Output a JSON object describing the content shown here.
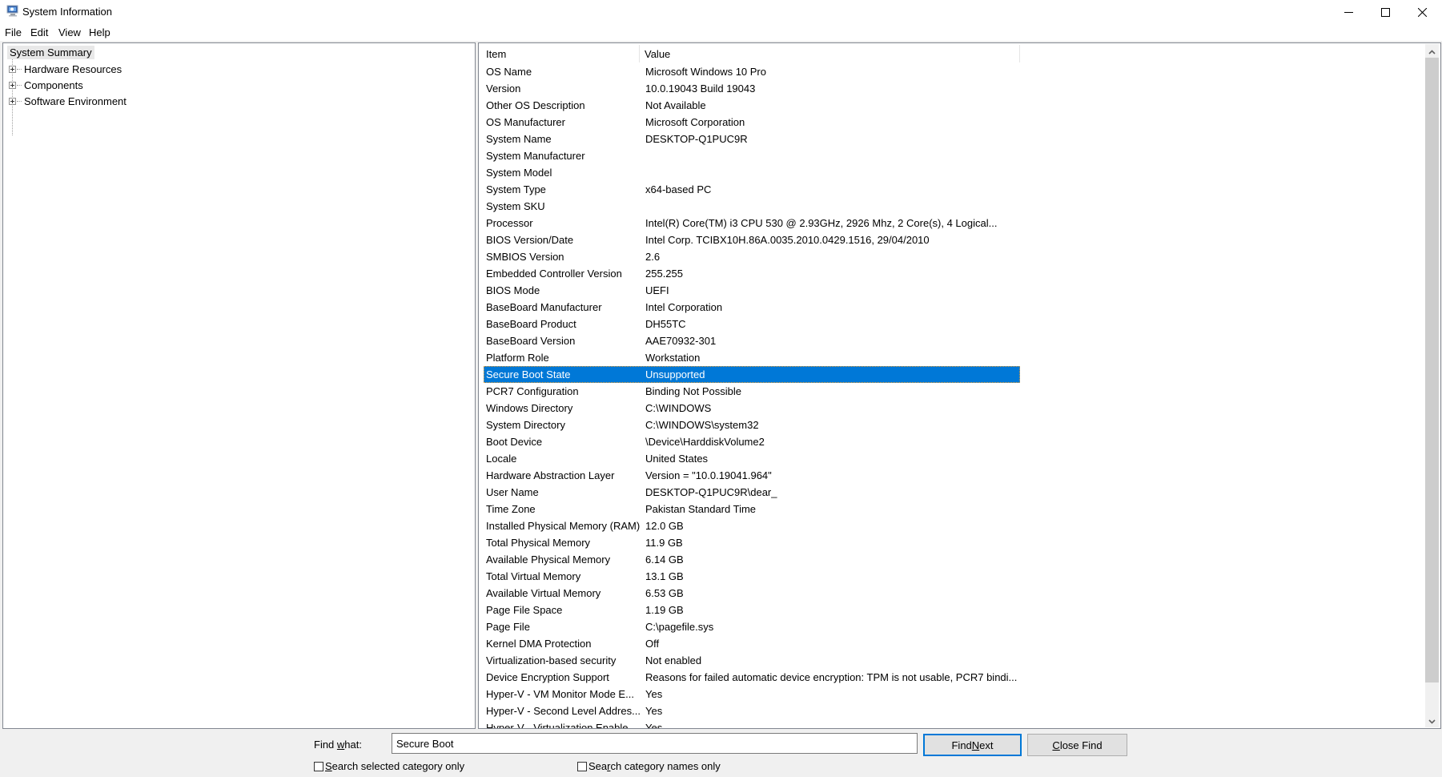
{
  "window": {
    "title": "System Information",
    "controls": {
      "minimize": "minimize",
      "maximize": "maximize",
      "close": "close"
    }
  },
  "menu": {
    "items": [
      "File",
      "Edit",
      "View",
      "Help"
    ]
  },
  "tree": {
    "root": "System Summary",
    "children": [
      "Hardware Resources",
      "Components",
      "Software Environment"
    ]
  },
  "list": {
    "headers": {
      "item": "Item",
      "value": "Value"
    },
    "selected_index": 18,
    "rows": [
      {
        "item": "OS Name",
        "value": "Microsoft Windows 10 Pro"
      },
      {
        "item": "Version",
        "value": "10.0.19043 Build 19043"
      },
      {
        "item": "Other OS Description",
        "value": "Not Available"
      },
      {
        "item": "OS Manufacturer",
        "value": "Microsoft Corporation"
      },
      {
        "item": "System Name",
        "value": "DESKTOP-Q1PUC9R"
      },
      {
        "item": "System Manufacturer",
        "value": ""
      },
      {
        "item": "System Model",
        "value": ""
      },
      {
        "item": "System Type",
        "value": "x64-based PC"
      },
      {
        "item": "System SKU",
        "value": ""
      },
      {
        "item": "Processor",
        "value": "Intel(R) Core(TM) i3 CPU         530  @ 2.93GHz, 2926 Mhz, 2 Core(s), 4 Logical..."
      },
      {
        "item": "BIOS Version/Date",
        "value": "Intel Corp. TCIBX10H.86A.0035.2010.0429.1516, 29/04/2010"
      },
      {
        "item": "SMBIOS Version",
        "value": "2.6"
      },
      {
        "item": "Embedded Controller Version",
        "value": "255.255"
      },
      {
        "item": "BIOS Mode",
        "value": "UEFI"
      },
      {
        "item": "BaseBoard Manufacturer",
        "value": "Intel Corporation"
      },
      {
        "item": "BaseBoard Product",
        "value": "DH55TC"
      },
      {
        "item": "BaseBoard Version",
        "value": "AAE70932-301"
      },
      {
        "item": "Platform Role",
        "value": "Workstation"
      },
      {
        "item": "Secure Boot State",
        "value": "Unsupported"
      },
      {
        "item": "PCR7 Configuration",
        "value": "Binding Not Possible"
      },
      {
        "item": "Windows Directory",
        "value": "C:\\WINDOWS"
      },
      {
        "item": "System Directory",
        "value": "C:\\WINDOWS\\system32"
      },
      {
        "item": "Boot Device",
        "value": "\\Device\\HarddiskVolume2"
      },
      {
        "item": "Locale",
        "value": "United States"
      },
      {
        "item": "Hardware Abstraction Layer",
        "value": "Version = \"10.0.19041.964\""
      },
      {
        "item": "User Name",
        "value": "DESKTOP-Q1PUC9R\\dear_"
      },
      {
        "item": "Time Zone",
        "value": "Pakistan Standard Time"
      },
      {
        "item": "Installed Physical Memory (RAM)",
        "value": "12.0 GB"
      },
      {
        "item": "Total Physical Memory",
        "value": "11.9 GB"
      },
      {
        "item": "Available Physical Memory",
        "value": "6.14 GB"
      },
      {
        "item": "Total Virtual Memory",
        "value": "13.1 GB"
      },
      {
        "item": "Available Virtual Memory",
        "value": "6.53 GB"
      },
      {
        "item": "Page File Space",
        "value": "1.19 GB"
      },
      {
        "item": "Page File",
        "value": "C:\\pagefile.sys"
      },
      {
        "item": "Kernel DMA Protection",
        "value": "Off"
      },
      {
        "item": "Virtualization-based security",
        "value": "Not enabled"
      },
      {
        "item": "Device Encryption Support",
        "value": "Reasons for failed automatic device encryption: TPM is not usable, PCR7 bindi..."
      },
      {
        "item": "Hyper-V - VM Monitor Mode E...",
        "value": "Yes"
      },
      {
        "item": "Hyper-V - Second Level Addres...",
        "value": "Yes"
      },
      {
        "item": "Hyper-V - Virtualization Enable...",
        "value": "Yes"
      }
    ]
  },
  "find": {
    "label_pre": "Find ",
    "label_accel": "w",
    "label_post": "hat:",
    "value": "Secure Boot",
    "find_next_pre": "Find ",
    "find_next_accel": "N",
    "find_next_post": "ext",
    "close_find_accel": "C",
    "close_find_post": "lose Find",
    "option1_accel": "S",
    "option1_post": "earch selected category only",
    "option1_checked": false,
    "option2_pre": "Sea",
    "option2_accel": "r",
    "option2_post": "ch category names only",
    "option2_checked": false
  }
}
